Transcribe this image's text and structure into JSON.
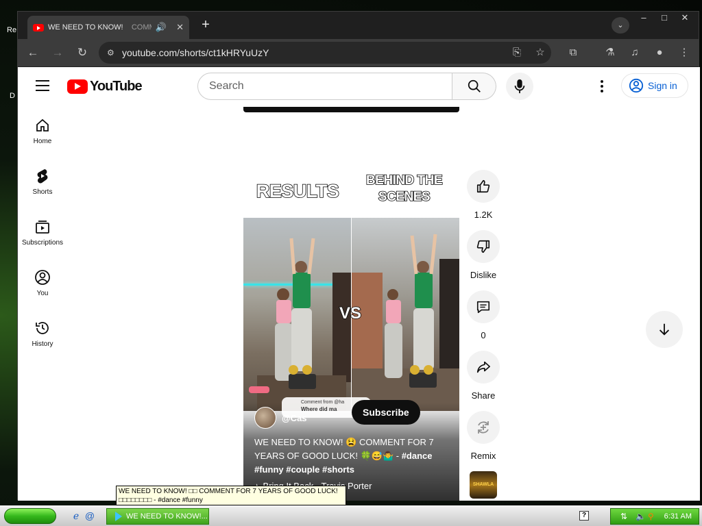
{
  "desktop": {
    "label_top": "Re",
    "label_mid": "D"
  },
  "browser": {
    "tab": {
      "title": "WE NEED TO KNOW!",
      "title_fade": "COMM",
      "audio_icon": "speaker-icon",
      "close_icon": "close-icon"
    },
    "new_tab": "+",
    "url": "youtube.com/shorts/ct1kHRYuUzY",
    "window_controls": [
      "–",
      "□",
      "✕"
    ]
  },
  "youtube": {
    "logo_text": "YouTube",
    "search": {
      "placeholder": "Search"
    },
    "sign_in": "Sign in",
    "guide": [
      {
        "label": "Home",
        "icon": "home-icon"
      },
      {
        "label": "Shorts",
        "icon": "shorts-icon"
      },
      {
        "label": "Subscriptions",
        "icon": "subscriptions-icon"
      },
      {
        "label": "You",
        "icon": "you-icon"
      },
      {
        "label": "History",
        "icon": "history-icon"
      }
    ],
    "short": {
      "header_left": "RESULTS",
      "header_right_1": "BEHIND THE",
      "header_right_2": "SCENES",
      "center_text": "VS",
      "channel_handle": "@Cas",
      "comment_chip_1": "Comment from @ha",
      "comment_chip_2": "Where did ma",
      "subscribe_label": "Subscribe",
      "caption_plain": "WE NEED TO KNOW! 😫 COMMENT FOR 7 YEARS OF GOOD LUCK! 🍀😅🤷‍♂️ - ",
      "caption_tags": "#dance #funny #couple #shorts",
      "music": "Bring It Back · Travis Porter"
    },
    "actions": [
      {
        "label": "1.2K",
        "icon": "like-icon"
      },
      {
        "label": "Dislike",
        "icon": "dislike-icon"
      },
      {
        "label": "0",
        "icon": "comment-icon"
      },
      {
        "label": "Share",
        "icon": "share-icon"
      },
      {
        "label": "Remix",
        "icon": "remix-icon"
      }
    ],
    "sound_thumb_text": "SHAWLA"
  },
  "tooltip": {
    "line1": "WE NEED TO KNOW! □□ COMMENT FOR 7 YEARS OF GOOD LUCK!",
    "line2": "□□□□□□□□ - #dance #funny"
  },
  "taskbar": {
    "task_title": "WE NEED TO KNOW!...",
    "clock": "6:31 AM",
    "help": "?"
  }
}
